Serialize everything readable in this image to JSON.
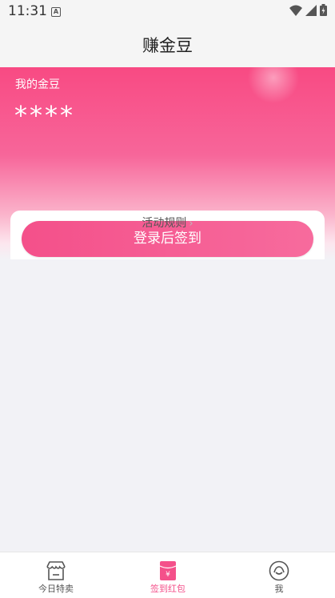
{
  "status_bar": {
    "time": "11:31",
    "a_badge": "A"
  },
  "header": {
    "title": "赚金豆"
  },
  "beans": {
    "label": "我的金豆",
    "value": "****"
  },
  "signin": {
    "button_label": "登录后签到"
  },
  "rules": {
    "label": "活动规则"
  },
  "tabbar": {
    "active_color": "#f4508a",
    "tabs": [
      {
        "label": "今日特卖",
        "icon": "shop-icon"
      },
      {
        "label": "签到红包",
        "icon": "red-envelope-icon",
        "active": true
      },
      {
        "label": "我",
        "icon": "profile-icon"
      }
    ]
  }
}
